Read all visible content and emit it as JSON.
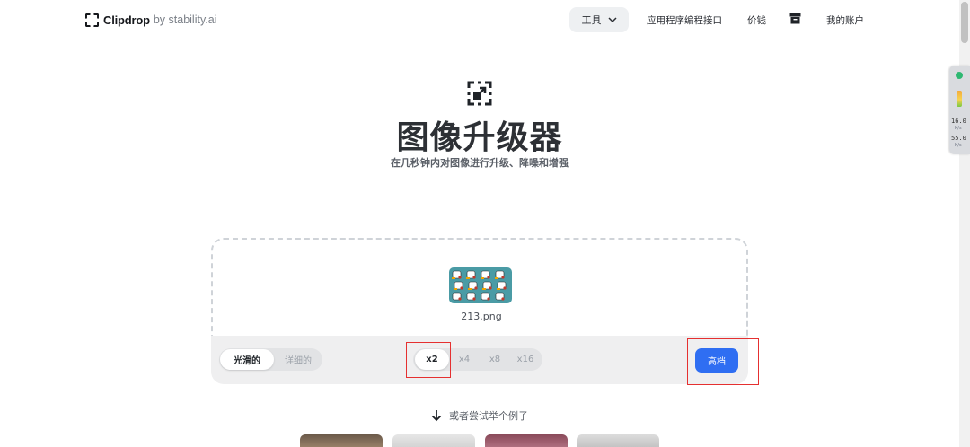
{
  "brand": {
    "name": "Clipdrop",
    "by": "by stability.ai"
  },
  "nav": {
    "tools_label": "工具",
    "api_label": "应用程序编程接口",
    "pricing_label": "价钱",
    "account_label": "我的账户"
  },
  "hero": {
    "title": "图像升级器",
    "subtitle": "在几秒钟内对图像进行升级、降噪和增强"
  },
  "upload": {
    "filename": "213.png"
  },
  "modes": {
    "options": [
      "光滑的",
      "详细的"
    ],
    "selected": "光滑的"
  },
  "scale": {
    "options": [
      "x2",
      "x4",
      "x8",
      "x16"
    ],
    "selected": "x2"
  },
  "action": {
    "upscale_label": "高档"
  },
  "examples": {
    "prompt": "或者尝试举个例子"
  },
  "monitor_widget": {
    "value_1": "16.0",
    "unit_1": "K/s",
    "value_2": "55.0",
    "unit_2": "K/s"
  },
  "colors": {
    "accent": "#2f6ef2",
    "annotation": "#e53030",
    "thumbnail_bg": "#4a9ba5"
  }
}
